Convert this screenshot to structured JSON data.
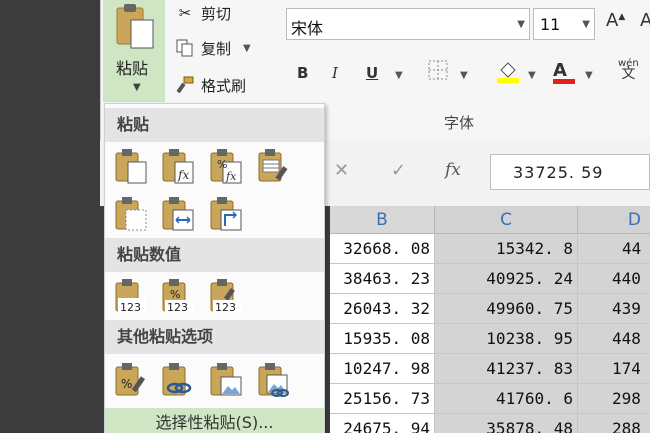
{
  "ribbon": {
    "paste_label": "粘贴",
    "cut_label": "剪切",
    "copy_label": "复制",
    "format_painter_label": "格式刷",
    "font_name": "宋体",
    "font_size": "11",
    "bold": "B",
    "italic": "I",
    "underline": "U",
    "font_color_letter": "A",
    "wen_label": "wén",
    "wen_char": "文",
    "font_group_label": "字体",
    "grow_font": "A",
    "accent_green": "#cfe5c3"
  },
  "formula_bar": {
    "fx_label": "fx",
    "value": "33725. 59"
  },
  "columns": [
    "B",
    "C",
    "D"
  ],
  "rows": [
    [
      "32668. 08",
      "15342. 8",
      "44"
    ],
    [
      "38463. 23",
      "40925. 24",
      "440"
    ],
    [
      "26043. 32",
      "49960. 75",
      "439"
    ],
    [
      "15935. 08",
      "10238. 95",
      "448"
    ],
    [
      "10247. 98",
      "41237. 83",
      "174"
    ],
    [
      "25156. 73",
      "41760. 6",
      "298"
    ],
    [
      "24675. 94",
      "35878. 48",
      "288"
    ]
  ],
  "paste_menu": {
    "section1": "粘贴",
    "section2": "粘贴数值",
    "section3": "其他粘贴选项",
    "special_label": "选择性粘贴(S)...",
    "num_label": "123",
    "pct_label": "%",
    "fx_label": "fx"
  }
}
